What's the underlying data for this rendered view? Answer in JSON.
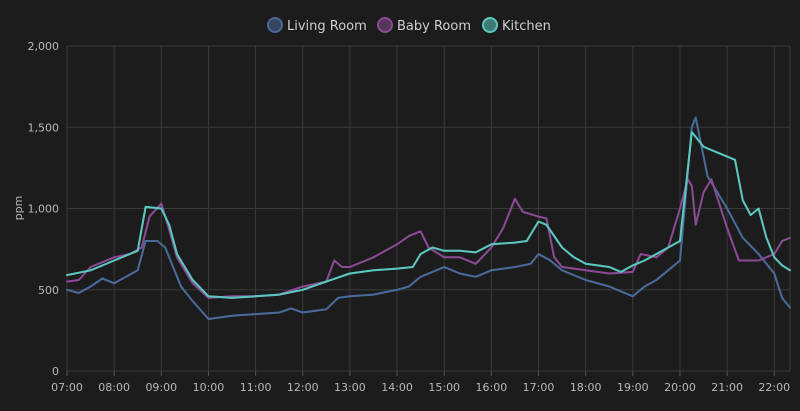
{
  "chart_data": {
    "type": "line",
    "title": "",
    "xlabel": "",
    "ylabel": "ppm",
    "ylim": [
      0,
      2000
    ],
    "xlim": [
      "07:00",
      "22:20"
    ],
    "legend_position": "top-center",
    "grid": true,
    "y_ticks": [
      {
        "value": 0,
        "label": "0"
      },
      {
        "value": 500,
        "label": "500"
      },
      {
        "value": 1000,
        "label": "1,000"
      },
      {
        "value": 1500,
        "label": "1,500"
      },
      {
        "value": 2000,
        "label": "2,000"
      }
    ],
    "x_ticks": [
      "07:00",
      "08:00",
      "09:00",
      "10:00",
      "11:00",
      "12:00",
      "13:00",
      "14:00",
      "15:00",
      "16:00",
      "17:00",
      "18:00",
      "19:00",
      "20:00",
      "21:00",
      "22:00"
    ],
    "series": [
      {
        "name": "Living Room",
        "color": "#4a6a9a",
        "points": [
          [
            "07:00",
            500
          ],
          [
            "07:15",
            480
          ],
          [
            "07:30",
            520
          ],
          [
            "07:45",
            570
          ],
          [
            "08:00",
            540
          ],
          [
            "08:15",
            580
          ],
          [
            "08:30",
            620
          ],
          [
            "08:40",
            800
          ],
          [
            "08:55",
            800
          ],
          [
            "09:05",
            760
          ],
          [
            "09:15",
            640
          ],
          [
            "09:25",
            520
          ],
          [
            "09:40",
            430
          ],
          [
            "10:00",
            320
          ],
          [
            "10:30",
            340
          ],
          [
            "11:00",
            350
          ],
          [
            "11:30",
            360
          ],
          [
            "11:45",
            385
          ],
          [
            "12:00",
            360
          ],
          [
            "12:30",
            380
          ],
          [
            "12:45",
            450
          ],
          [
            "13:00",
            460
          ],
          [
            "13:30",
            470
          ],
          [
            "14:00",
            500
          ],
          [
            "14:15",
            520
          ],
          [
            "14:30",
            580
          ],
          [
            "14:50",
            620
          ],
          [
            "15:00",
            640
          ],
          [
            "15:20",
            600
          ],
          [
            "15:40",
            580
          ],
          [
            "16:00",
            620
          ],
          [
            "16:30",
            640
          ],
          [
            "16:50",
            660
          ],
          [
            "17:00",
            720
          ],
          [
            "17:15",
            680
          ],
          [
            "17:30",
            620
          ],
          [
            "18:00",
            560
          ],
          [
            "18:30",
            520
          ],
          [
            "19:00",
            460
          ],
          [
            "19:15",
            520
          ],
          [
            "19:30",
            560
          ],
          [
            "19:45",
            620
          ],
          [
            "20:00",
            680
          ],
          [
            "20:15",
            1500
          ],
          [
            "20:20",
            1560
          ],
          [
            "20:35",
            1200
          ],
          [
            "21:00",
            1000
          ],
          [
            "21:20",
            820
          ],
          [
            "21:40",
            720
          ],
          [
            "22:00",
            600
          ],
          [
            "22:10",
            450
          ],
          [
            "22:20",
            390
          ]
        ]
      },
      {
        "name": "Baby Room",
        "color": "#8a4a94",
        "points": [
          [
            "07:00",
            550
          ],
          [
            "07:15",
            560
          ],
          [
            "07:30",
            640
          ],
          [
            "08:00",
            700
          ],
          [
            "08:20",
            720
          ],
          [
            "08:35",
            760
          ],
          [
            "08:45",
            950
          ],
          [
            "09:00",
            1030
          ],
          [
            "09:10",
            870
          ],
          [
            "09:20",
            700
          ],
          [
            "09:40",
            540
          ],
          [
            "10:00",
            450
          ],
          [
            "10:30",
            460
          ],
          [
            "11:00",
            460
          ],
          [
            "11:30",
            470
          ],
          [
            "12:00",
            520
          ],
          [
            "12:30",
            550
          ],
          [
            "12:40",
            680
          ],
          [
            "12:50",
            640
          ],
          [
            "13:00",
            640
          ],
          [
            "13:30",
            700
          ],
          [
            "14:00",
            780
          ],
          [
            "14:15",
            830
          ],
          [
            "14:30",
            860
          ],
          [
            "14:40",
            760
          ],
          [
            "15:00",
            700
          ],
          [
            "15:20",
            700
          ],
          [
            "15:40",
            660
          ],
          [
            "16:00",
            760
          ],
          [
            "16:15",
            880
          ],
          [
            "16:30",
            1060
          ],
          [
            "16:40",
            980
          ],
          [
            "17:00",
            950
          ],
          [
            "17:10",
            940
          ],
          [
            "17:20",
            700
          ],
          [
            "17:30",
            640
          ],
          [
            "18:00",
            620
          ],
          [
            "18:30",
            600
          ],
          [
            "19:00",
            610
          ],
          [
            "19:10",
            720
          ],
          [
            "19:30",
            700
          ],
          [
            "19:45",
            760
          ],
          [
            "20:00",
            1000
          ],
          [
            "20:10",
            1180
          ],
          [
            "20:15",
            1140
          ],
          [
            "20:20",
            900
          ],
          [
            "20:30",
            1100
          ],
          [
            "20:40",
            1180
          ],
          [
            "21:00",
            880
          ],
          [
            "21:15",
            680
          ],
          [
            "21:40",
            680
          ],
          [
            "22:00",
            720
          ],
          [
            "22:10",
            800
          ],
          [
            "22:20",
            820
          ]
        ]
      },
      {
        "name": "Kitchen",
        "color": "#5bc8c0",
        "points": [
          [
            "07:00",
            590
          ],
          [
            "07:30",
            620
          ],
          [
            "08:00",
            680
          ],
          [
            "08:30",
            740
          ],
          [
            "08:40",
            1010
          ],
          [
            "09:00",
            1000
          ],
          [
            "09:10",
            900
          ],
          [
            "09:20",
            720
          ],
          [
            "09:40",
            560
          ],
          [
            "10:00",
            460
          ],
          [
            "10:30",
            450
          ],
          [
            "11:00",
            460
          ],
          [
            "11:30",
            470
          ],
          [
            "12:00",
            500
          ],
          [
            "12:30",
            550
          ],
          [
            "13:00",
            600
          ],
          [
            "13:30",
            620
          ],
          [
            "14:00",
            630
          ],
          [
            "14:20",
            640
          ],
          [
            "14:30",
            720
          ],
          [
            "14:45",
            760
          ],
          [
            "15:00",
            740
          ],
          [
            "15:20",
            740
          ],
          [
            "15:40",
            730
          ],
          [
            "16:00",
            780
          ],
          [
            "16:30",
            790
          ],
          [
            "16:45",
            800
          ],
          [
            "17:00",
            920
          ],
          [
            "17:10",
            900
          ],
          [
            "17:30",
            760
          ],
          [
            "17:45",
            700
          ],
          [
            "18:00",
            660
          ],
          [
            "18:30",
            640
          ],
          [
            "18:45",
            610
          ],
          [
            "19:00",
            650
          ],
          [
            "19:15",
            680
          ],
          [
            "19:30",
            720
          ],
          [
            "19:45",
            760
          ],
          [
            "20:00",
            800
          ],
          [
            "20:15",
            1470
          ],
          [
            "20:30",
            1380
          ],
          [
            "20:50",
            1340
          ],
          [
            "21:10",
            1300
          ],
          [
            "21:20",
            1050
          ],
          [
            "21:30",
            960
          ],
          [
            "21:40",
            1000
          ],
          [
            "21:50",
            820
          ],
          [
            "22:00",
            700
          ],
          [
            "22:10",
            650
          ],
          [
            "22:20",
            620
          ]
        ]
      }
    ]
  }
}
